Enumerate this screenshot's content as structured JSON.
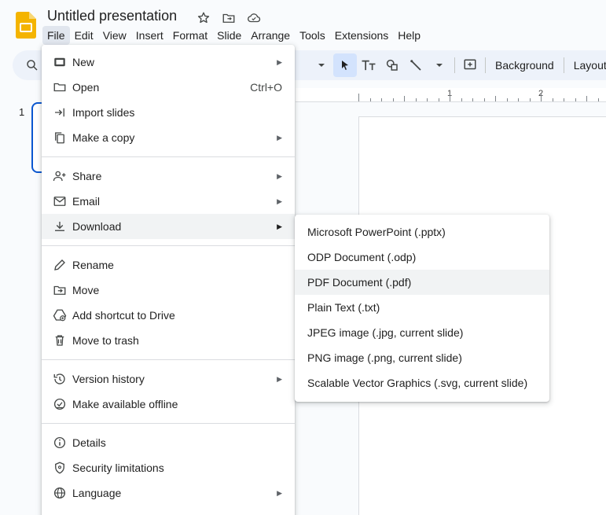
{
  "app": {
    "doc_title": "Untitled presentation",
    "logo_icon": "google-slides-logo",
    "brand_color": "#f4b400"
  },
  "menubar": [
    "File",
    "Edit",
    "View",
    "Insert",
    "Format",
    "Slide",
    "Arrange",
    "Tools",
    "Extensions",
    "Help"
  ],
  "toolbar": {
    "background_label": "Background",
    "layout_label": "Layout"
  },
  "filmstrip": {
    "slide_number": "1"
  },
  "ruler": {
    "labels": [
      "1",
      "2"
    ]
  },
  "file_menu": {
    "groups": [
      [
        {
          "label": "New",
          "icon": "new-slides-icon",
          "submenu": true
        },
        {
          "label": "Open",
          "icon": "folder-open-icon",
          "shortcut": "Ctrl+O"
        },
        {
          "label": "Import slides",
          "icon": "import-icon"
        },
        {
          "label": "Make a copy",
          "icon": "copy-icon",
          "submenu": true
        }
      ],
      [
        {
          "label": "Share",
          "icon": "person-add-icon",
          "submenu": true
        },
        {
          "label": "Email",
          "icon": "mail-icon",
          "submenu": true
        },
        {
          "label": "Download",
          "icon": "download-icon",
          "submenu": true,
          "highlighted": true
        }
      ],
      [
        {
          "label": "Rename",
          "icon": "pencil-icon"
        },
        {
          "label": "Move",
          "icon": "move-folder-icon"
        },
        {
          "label": "Add shortcut to Drive",
          "icon": "drive-shortcut-icon"
        },
        {
          "label": "Move to trash",
          "icon": "trash-icon"
        }
      ],
      [
        {
          "label": "Version history",
          "icon": "history-icon",
          "submenu": true
        },
        {
          "label": "Make available offline",
          "icon": "offline-icon"
        }
      ],
      [
        {
          "label": "Details",
          "icon": "info-icon"
        },
        {
          "label": "Security limitations",
          "icon": "shield-icon"
        },
        {
          "label": "Language",
          "icon": "globe-icon",
          "submenu": true
        }
      ]
    ]
  },
  "download_menu": [
    {
      "label": "Microsoft PowerPoint (.pptx)"
    },
    {
      "label": "ODP Document (.odp)"
    },
    {
      "label": "PDF Document (.pdf)",
      "highlighted": true
    },
    {
      "label": "Plain Text (.txt)"
    },
    {
      "label": "JPEG image (.jpg, current slide)"
    },
    {
      "label": "PNG image (.png, current slide)"
    },
    {
      "label": "Scalable Vector Graphics (.svg, current slide)"
    }
  ]
}
